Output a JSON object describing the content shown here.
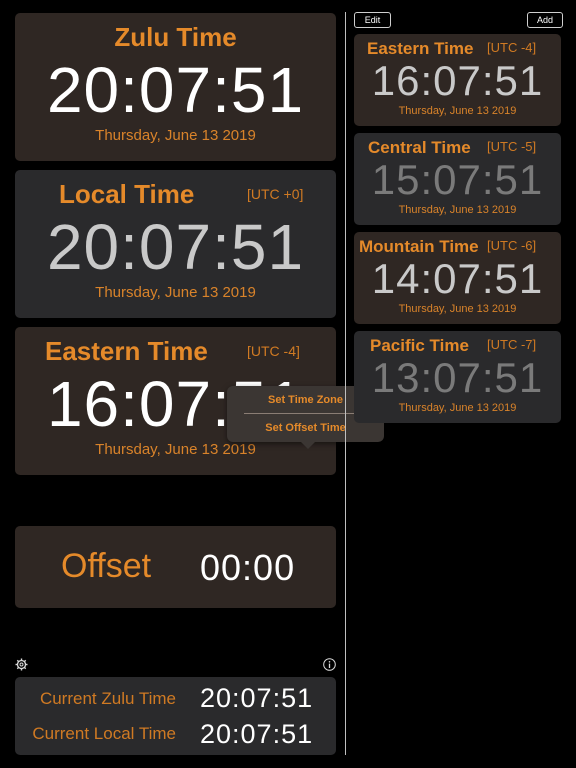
{
  "left": {
    "zulu": {
      "title": "Zulu Time",
      "time": "20:07:51",
      "date": "Thursday, June 13 2019"
    },
    "local": {
      "title": "Local Time",
      "utc": "[UTC +0]",
      "time": "20:07:51",
      "date": "Thursday, June 13 2019"
    },
    "eastern": {
      "title": "Eastern Time",
      "utc": "[UTC -4]",
      "time": "16:07:51",
      "date": "Thursday, June 13 2019"
    },
    "offset": {
      "label": "Offset",
      "value": "00:00"
    }
  },
  "popup": {
    "set_time_zone": "Set Time Zone",
    "set_offset_time": "Set Offset Time"
  },
  "footer": {
    "current_zulu_label": "Current Zulu Time",
    "current_zulu_value": "20:07:51",
    "current_local_label": "Current Local Time",
    "current_local_value": "20:07:51"
  },
  "toolbar": {
    "edit": "Edit",
    "add": "Add"
  },
  "right": [
    {
      "title": "Eastern Time",
      "utc": "[UTC -4]",
      "time": "16:07:51",
      "date": "Thursday, June 13 2019"
    },
    {
      "title": "Central Time",
      "utc": "[UTC -5]",
      "time": "15:07:51",
      "date": "Thursday, June 13 2019"
    },
    {
      "title": "Mountain Time",
      "utc": "[UTC -6]",
      "time": "14:07:51",
      "date": "Thursday, June 13 2019"
    },
    {
      "title": "Pacific Time",
      "utc": "[UTC -7]",
      "time": "13:07:51",
      "date": "Thursday, June 13 2019"
    }
  ],
  "icons": {
    "settings": "gear-icon",
    "info": "info-icon"
  },
  "colors": {
    "accent": "#e58a2a",
    "card_brown": "#2f2723",
    "card_grey": "#2a2a2c",
    "background": "#000000"
  }
}
